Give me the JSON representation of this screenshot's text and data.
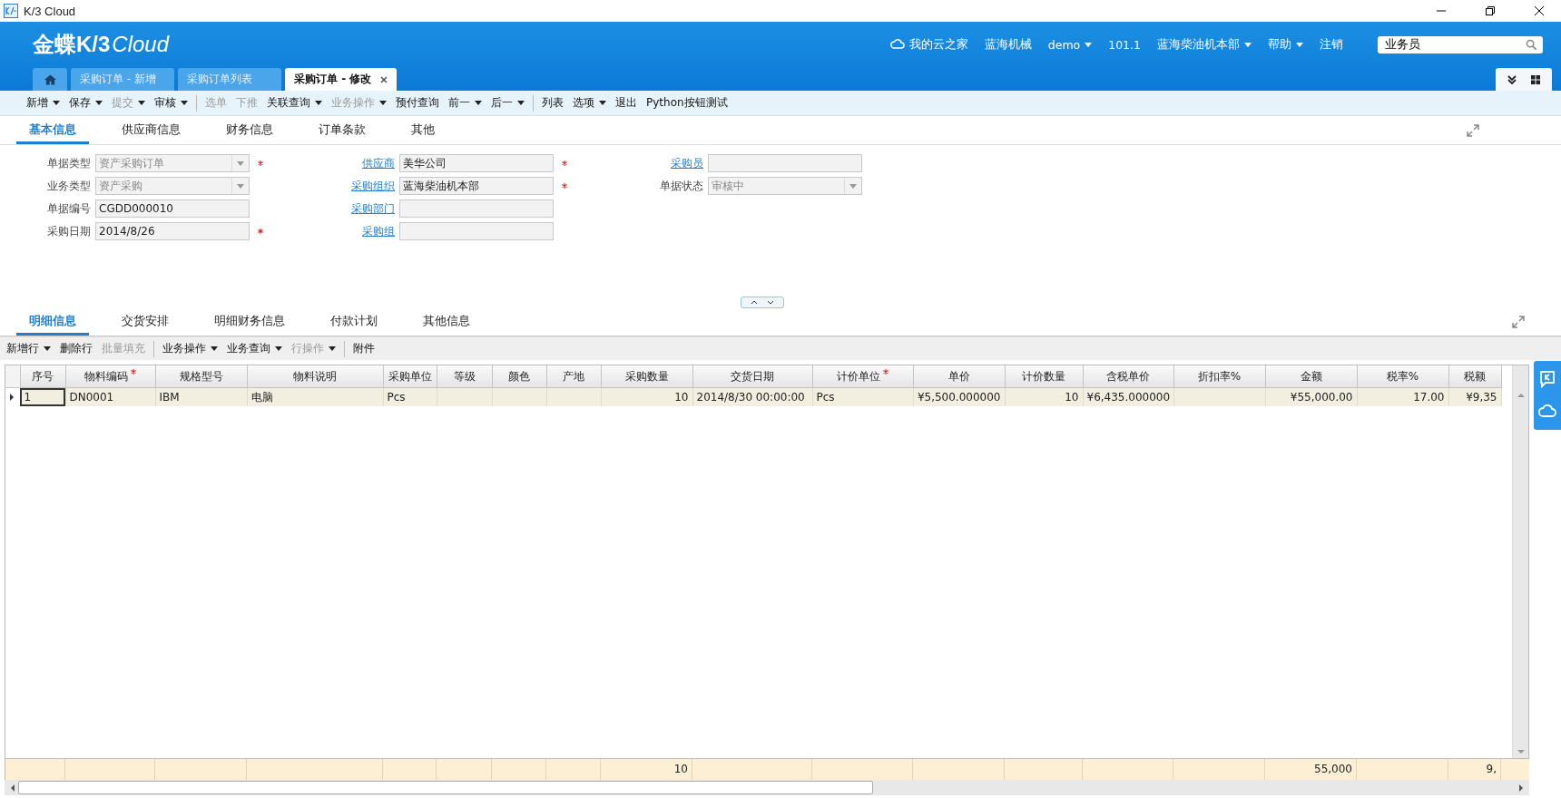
{
  "window": {
    "title": "K/3 Cloud"
  },
  "header": {
    "brand": "金蝶K/3",
    "product": "Cloud",
    "links": [
      {
        "kind": "cloud",
        "label": "我的云之家"
      },
      {
        "kind": "plain",
        "label": "蓝海机械"
      },
      {
        "kind": "menu",
        "label": "demo"
      },
      {
        "kind": "plain",
        "label": "101.1"
      },
      {
        "kind": "menu",
        "label": "蓝海柴油机本部"
      },
      {
        "kind": "menu",
        "label": "帮助"
      },
      {
        "kind": "plain",
        "label": "注销"
      }
    ],
    "search": {
      "value": "业务员"
    }
  },
  "doc_tabs": [
    {
      "kind": "home",
      "selected": false
    },
    {
      "kind": "page",
      "label": "采购订单 - 新增",
      "selected": false
    },
    {
      "kind": "page",
      "label": "采购订单列表",
      "selected": false
    },
    {
      "kind": "page",
      "label": "采购订单 - 修改",
      "selected": true
    }
  ],
  "toolbar": [
    {
      "label": "新增",
      "menu": true,
      "disabled": false,
      "separator": false
    },
    {
      "label": "保存",
      "menu": true,
      "disabled": false,
      "separator": false
    },
    {
      "label": "提交",
      "menu": true,
      "disabled": true,
      "separator": false
    },
    {
      "label": "审核",
      "menu": true,
      "disabled": false,
      "separator": false
    },
    {
      "label": "选单",
      "menu": false,
      "disabled": true,
      "separator": true
    },
    {
      "label": "下推",
      "menu": false,
      "disabled": true,
      "separator": false
    },
    {
      "label": "关联查询",
      "menu": true,
      "disabled": false,
      "separator": false
    },
    {
      "label": "业务操作",
      "menu": true,
      "disabled": true,
      "separator": false
    },
    {
      "label": "预付查询",
      "menu": false,
      "disabled": false,
      "separator": false
    },
    {
      "label": "前一",
      "menu": true,
      "disabled": false,
      "separator": false
    },
    {
      "label": "后一",
      "menu": true,
      "disabled": false,
      "separator": false
    },
    {
      "label": "列表",
      "menu": false,
      "disabled": false,
      "separator": true
    },
    {
      "label": "选项",
      "menu": true,
      "disabled": false,
      "separator": false
    },
    {
      "label": "退出",
      "menu": false,
      "disabled": false,
      "separator": false
    },
    {
      "label": "Python按钮测试",
      "menu": false,
      "disabled": false,
      "separator": false
    }
  ],
  "form_tabs": [
    {
      "label": "基本信息",
      "selected": true
    },
    {
      "label": "供应商信息",
      "selected": false
    },
    {
      "label": "财务信息",
      "selected": false
    },
    {
      "label": "订单条款",
      "selected": false
    },
    {
      "label": "其他",
      "selected": false
    }
  ],
  "form_columns": [
    [
      {
        "label": "单据类型",
        "link": false,
        "kind": "combo",
        "value": "资产采购订单",
        "disabled": true,
        "required": true
      },
      {
        "label": "业务类型",
        "link": false,
        "kind": "combo",
        "value": "资产采购",
        "disabled": true,
        "required": false
      },
      {
        "label": "单据编号",
        "link": false,
        "kind": "text",
        "value": "CGDD000010",
        "disabled": false,
        "required": false
      },
      {
        "label": "采购日期",
        "link": false,
        "kind": "text",
        "value": "2014/8/26",
        "disabled": false,
        "required": true
      }
    ],
    [
      {
        "label": "供应商",
        "link": true,
        "kind": "text",
        "value": "美华公司",
        "disabled": false,
        "required": true
      },
      {
        "label": "采购组织",
        "link": true,
        "kind": "text",
        "value": "蓝海柴油机本部",
        "disabled": false,
        "required": true
      },
      {
        "label": "采购部门",
        "link": true,
        "kind": "text",
        "disabled": false,
        "required": false
      },
      {
        "label": "采购组",
        "link": true,
        "kind": "text",
        "disabled": false,
        "required": false
      }
    ],
    [
      {
        "label": "采购员",
        "link": true,
        "kind": "text",
        "disabled": false,
        "required": false
      },
      {
        "label": "单据状态",
        "link": false,
        "kind": "combo",
        "value": "审核中",
        "disabled": true,
        "required": false
      }
    ]
  ],
  "detail_tabs": [
    {
      "label": "明细信息",
      "selected": true
    },
    {
      "label": "交货安排",
      "selected": false
    },
    {
      "label": "明细财务信息",
      "selected": false
    },
    {
      "label": "付款计划",
      "selected": false
    },
    {
      "label": "其他信息",
      "selected": false
    }
  ],
  "detail_toolbar": [
    {
      "label": "新增行",
      "menu": true,
      "disabled": false,
      "separator": false
    },
    {
      "label": "删除行",
      "menu": false,
      "disabled": false,
      "separator": false
    },
    {
      "label": "批量填充",
      "menu": false,
      "disabled": true,
      "separator": false
    },
    {
      "label": "业务操作",
      "menu": true,
      "disabled": false,
      "separator": true
    },
    {
      "label": "业务查询",
      "menu": true,
      "disabled": false,
      "separator": false
    },
    {
      "label": "行操作",
      "menu": true,
      "disabled": true,
      "separator": false
    },
    {
      "label": "附件",
      "menu": false,
      "disabled": false,
      "separator": true
    }
  ],
  "table": {
    "columns": [
      {
        "label": "序号",
        "required": false,
        "cells": [
          "1"
        ]
      },
      {
        "label": "物料编码",
        "required": true,
        "cells": [
          "DN0001"
        ]
      },
      {
        "label": "规格型号",
        "required": false,
        "cells": [
          "IBM"
        ]
      },
      {
        "label": "物料说明",
        "required": false,
        "cells": [
          "电脑"
        ]
      },
      {
        "label": "采购单位",
        "required": false,
        "cells": [
          "Pcs"
        ]
      },
      {
        "label": "等级",
        "required": false
      },
      {
        "label": "颜色",
        "required": false
      },
      {
        "label": "产地",
        "required": false
      },
      {
        "label": "采购数量",
        "required": false,
        "cells": [
          "10"
        ],
        "total": "10"
      },
      {
        "label": "交货日期",
        "required": false,
        "cells": [
          "2014/8/30 00:00:00"
        ]
      },
      {
        "label": "计价单位",
        "required": true,
        "cells": [
          "Pcs"
        ]
      },
      {
        "label": "单价",
        "required": false,
        "cells": [
          "¥5,500.000000"
        ]
      },
      {
        "label": "计价数量",
        "required": false,
        "cells": [
          "10"
        ]
      },
      {
        "label": "含税单价",
        "required": false,
        "cells": [
          "¥6,435.000000"
        ]
      },
      {
        "label": "折扣率%",
        "required": false
      },
      {
        "label": "金额",
        "required": false,
        "cells": [
          "¥55,000.00"
        ],
        "total": "55,000"
      },
      {
        "label": "税率%",
        "required": false,
        "cells": [
          "17.00"
        ]
      },
      {
        "label": "税额",
        "required": false,
        "cells": [
          "¥9,35"
        ],
        "total": "9,"
      }
    ],
    "rows": [
      {
        "selected": true
      }
    ]
  }
}
